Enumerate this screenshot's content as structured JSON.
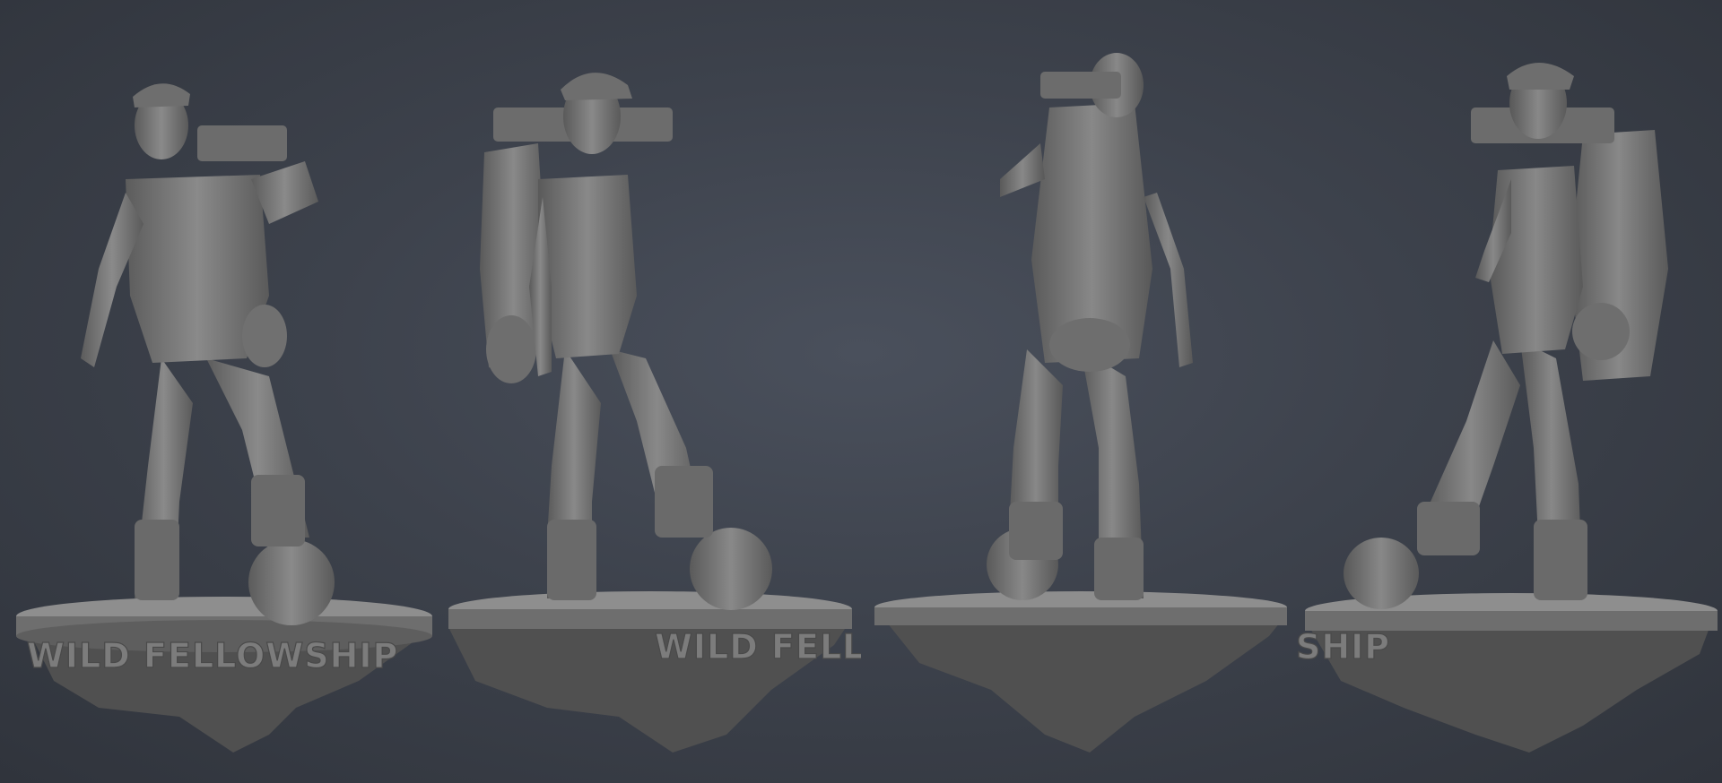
{
  "scene": {
    "background": "#3a3f49",
    "material_color": "#7a7a7a",
    "material_dark": "#4f4f4f",
    "material_light": "#9a9a9a",
    "views": [
      {
        "name": "front",
        "plate_text": "WILD FELLOWSHIP"
      },
      {
        "name": "side-left",
        "plate_text": "WILD FELLOW"
      },
      {
        "name": "back",
        "plate_text": ""
      },
      {
        "name": "side-right",
        "plate_text": "SHIP"
      }
    ]
  }
}
